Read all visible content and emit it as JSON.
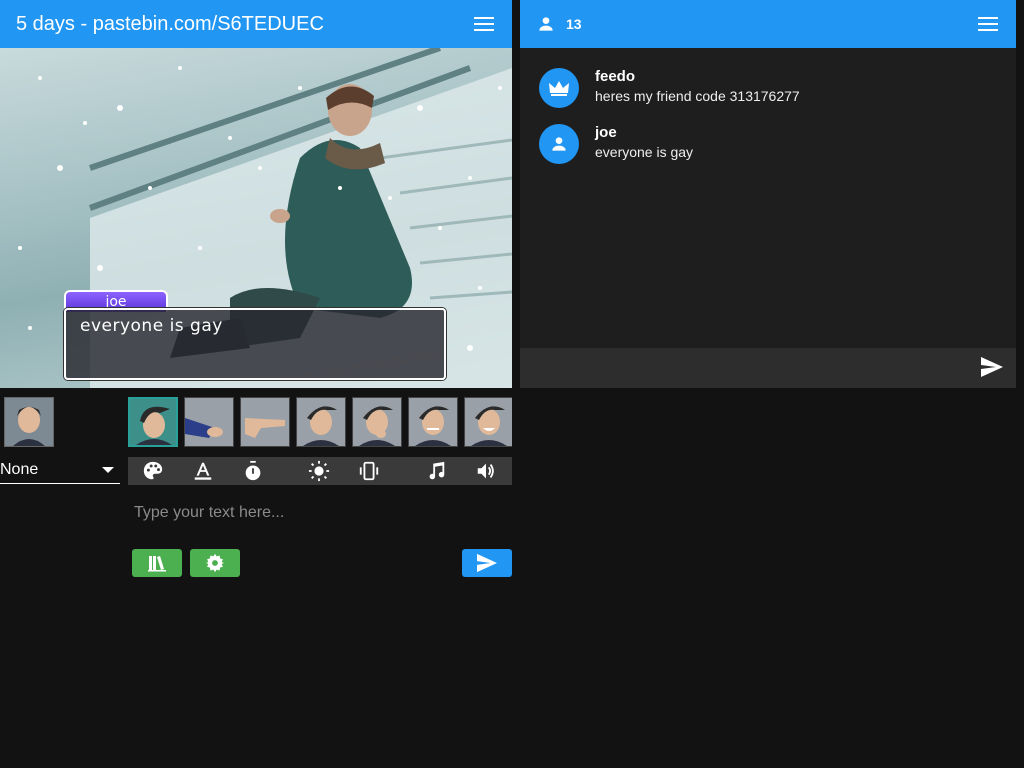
{
  "header": {
    "room_title": "5 days - pastebin.com/S6TEDUEC",
    "menu_icon": "hamburger-menu-icon"
  },
  "chat_header": {
    "user_count": "13",
    "users_icon": "person-icon",
    "menu_icon": "hamburger-menu-icon"
  },
  "viewport": {
    "nameplate": "joe",
    "dialogue": "everyone is gay"
  },
  "chat": {
    "messages": [
      {
        "name": "feedo",
        "text": "heres my friend code 313176277",
        "icon": "crown-icon"
      },
      {
        "name": "joe",
        "text": "everyone is gay",
        "icon": "person-icon"
      }
    ],
    "send_icon": "send-icon"
  },
  "controls": {
    "character_select": "None",
    "message_placeholder": "Type your text here...",
    "toolbar_icons": [
      "palette-icon",
      "text-color-icon",
      "timer-icon",
      "brightness-icon",
      "vibrate-icon",
      "music-note-icon",
      "volume-icon"
    ],
    "buttons": [
      "library-icon",
      "settings-icon",
      "send-icon"
    ]
  },
  "colors": {
    "primary": "#2196f3",
    "success": "#4caf50",
    "background": "#121212",
    "panel": "#1e1e1e",
    "nameplate": "#6a45e6"
  }
}
